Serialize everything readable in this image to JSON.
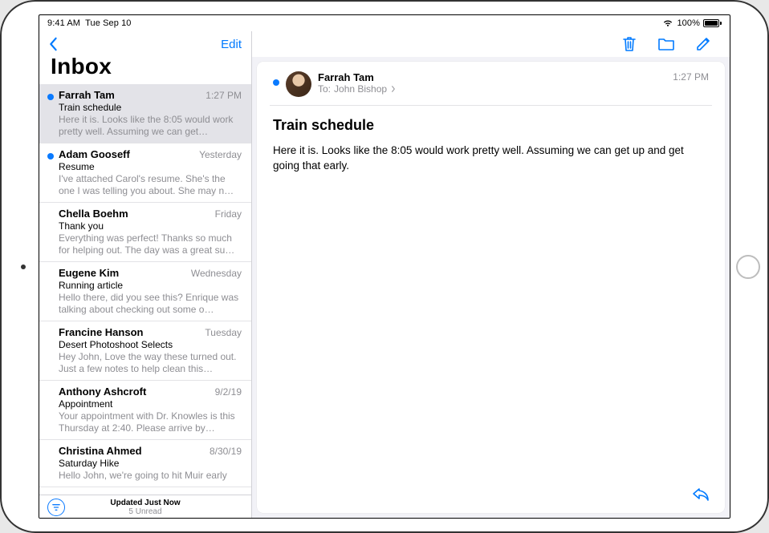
{
  "status": {
    "time": "9:41 AM",
    "date": "Tue Sep 10",
    "battery_pct": "100%"
  },
  "sidebar": {
    "edit_label": "Edit",
    "title": "Inbox",
    "messages": [
      {
        "unread": true,
        "from": "Farrah Tam",
        "time": "1:27 PM",
        "subject": "Train schedule",
        "preview": "Here it is. Looks like the 8:05 would work pretty well. Assuming we can get…",
        "selected": true
      },
      {
        "unread": true,
        "from": "Adam Gooseff",
        "time": "Yesterday",
        "subject": "Resume",
        "preview": "I've attached Carol's resume. She's the one I was telling you about. She may n…",
        "selected": false
      },
      {
        "unread": false,
        "from": "Chella Boehm",
        "time": "Friday",
        "subject": "Thank you",
        "preview": "Everything was perfect! Thanks so much for helping out. The day was a great su…",
        "selected": false
      },
      {
        "unread": false,
        "from": "Eugene Kim",
        "time": "Wednesday",
        "subject": "Running article",
        "preview": "Hello there, did you see this? Enrique was talking about checking out some o…",
        "selected": false
      },
      {
        "unread": false,
        "from": "Francine Hanson",
        "time": "Tuesday",
        "subject": "Desert Photoshoot Selects",
        "preview": "Hey John, Love the way these turned out. Just a few notes to help clean this…",
        "selected": false
      },
      {
        "unread": false,
        "from": "Anthony Ashcroft",
        "time": "9/2/19",
        "subject": "Appointment",
        "preview": "Your appointment with Dr. Knowles is this Thursday at 2:40. Please arrive by…",
        "selected": false
      },
      {
        "unread": false,
        "from": "Christina Ahmed",
        "time": "8/30/19",
        "subject": "Saturday Hike",
        "preview": "Hello John, we're going to hit Muir early",
        "selected": false
      }
    ],
    "footer": {
      "updated": "Updated Just Now",
      "unread_count": "5 Unread"
    }
  },
  "detail": {
    "from": "Farrah Tam",
    "to_label": "To:",
    "to_name": "John Bishop",
    "time": "1:27 PM",
    "subject": "Train schedule",
    "body": "Here it is. Looks like the 8:05 would work pretty well. Assuming we can get up and get going that early."
  }
}
